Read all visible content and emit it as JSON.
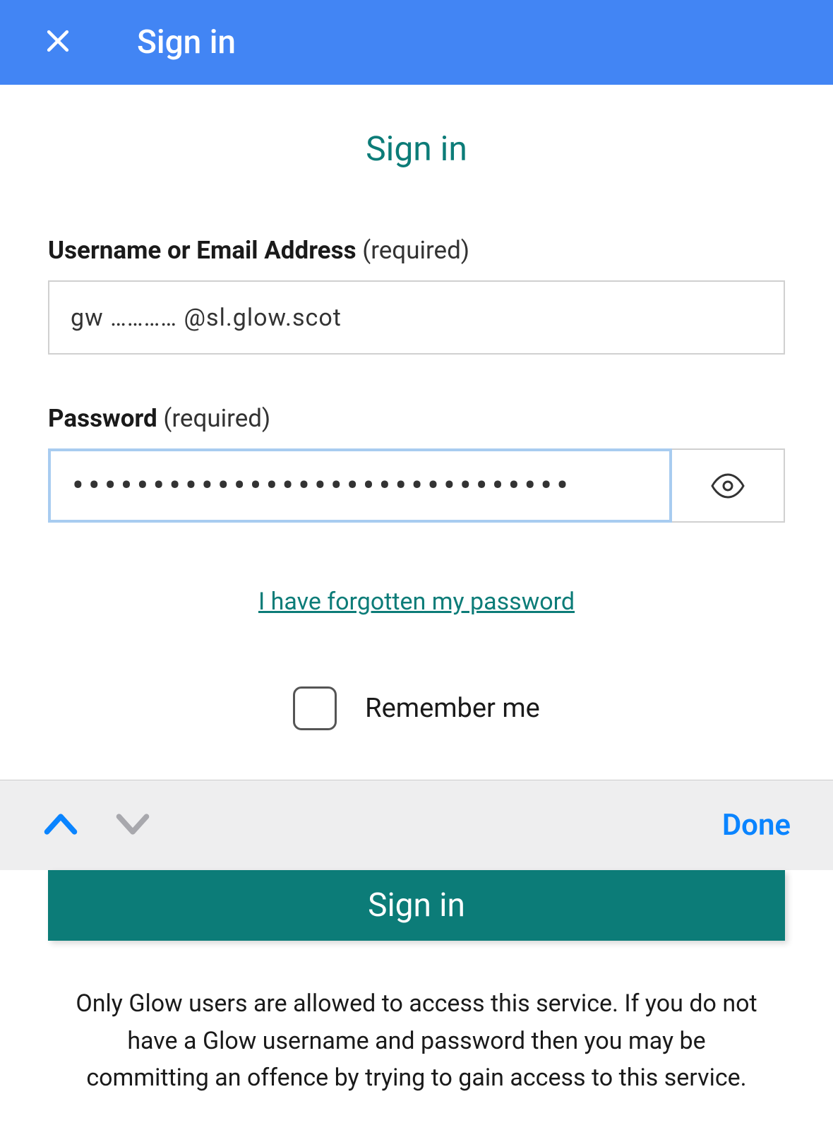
{
  "header": {
    "title": "Sign in"
  },
  "page": {
    "title": "Sign in"
  },
  "form": {
    "username": {
      "label": "Username or Email Address",
      "required": " (required)",
      "value": "gw ………… @sl.glow.scot"
    },
    "password": {
      "label": "Password",
      "required": " (required)",
      "value": "•••••••••••••••••••••••••••••••"
    },
    "forgot_link": "I have forgotten my password",
    "remember_label": "Remember me",
    "submit_label": "Sign in"
  },
  "keyboard": {
    "done_label": "Done"
  },
  "disclaimer": {
    "text": "Only Glow users are allowed to access this service. If you do not have a Glow username and password then you may be committing an offence by trying to gain access to this service."
  }
}
